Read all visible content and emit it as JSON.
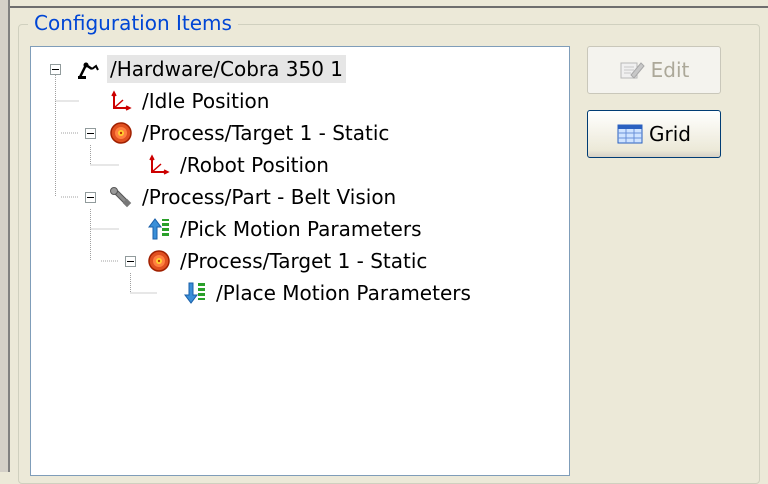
{
  "group": {
    "title": "Configuration Items"
  },
  "tree": {
    "nodes": [
      {
        "label": "/Hardware/Cobra 350 1",
        "icon": "robot-arm-icon",
        "selected": true
      },
      {
        "label": "/Idle Position",
        "icon": "coordinate-axes-icon"
      },
      {
        "label": "/Process/Target 1 - Static",
        "icon": "target-icon"
      },
      {
        "label": "/Robot Position",
        "icon": "coordinate-axes-icon"
      },
      {
        "label": "/Process/Part - Belt Vision",
        "icon": "wrench-icon"
      },
      {
        "label": "/Pick Motion Parameters",
        "icon": "pick-motion-icon"
      },
      {
        "label": "/Process/Target 1 - Static",
        "icon": "target-icon"
      },
      {
        "label": "/Place Motion Parameters",
        "icon": "place-motion-icon"
      }
    ]
  },
  "buttons": {
    "edit": {
      "label": "Edit",
      "icon": "edit-icon",
      "enabled": false
    },
    "grid": {
      "label": "Grid",
      "icon": "grid-icon",
      "enabled": true
    }
  },
  "colors": {
    "group_title": "#0046d5",
    "tree_border": "#7f9db9",
    "selection": "#e6e6e6"
  }
}
